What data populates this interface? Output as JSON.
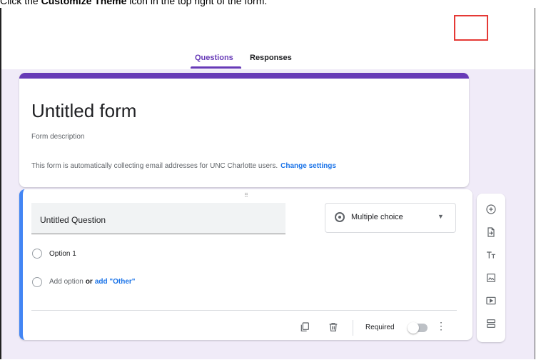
{
  "caption": {
    "prefix": "Click the ",
    "bold": "Customize Theme",
    "suffix": " icon in the top right of the form."
  },
  "tabs": [
    {
      "label": "Questions",
      "active": true
    },
    {
      "label": "Responses",
      "active": false
    }
  ],
  "form": {
    "title": "Untitled form",
    "description_placeholder": "Form description",
    "notice": "This form is automatically collecting email addresses for UNC Charlotte users.",
    "notice_link": "Change settings"
  },
  "question": {
    "drag_handle": "⠿",
    "title": "Untitled Question",
    "type": "Multiple choice",
    "options": [
      "Option 1"
    ],
    "add_option": "Add option",
    "or": "or",
    "add_other": "add \"Other\"",
    "required_label": "Required",
    "required": false
  },
  "top_icons": [
    "addon-puzzle-icon",
    "palette-icon",
    "eye-preview-icon",
    "settings-gear-icon"
  ],
  "side_tools": [
    "add-question-icon",
    "import-questions-icon",
    "title-text-icon",
    "image-icon",
    "video-icon",
    "section-icon"
  ],
  "colors": {
    "accent": "#673ab7",
    "canvas": "#f0ebf8",
    "link": "#1a73e8",
    "highlight": "#e53935",
    "active_border": "#4285f4"
  }
}
